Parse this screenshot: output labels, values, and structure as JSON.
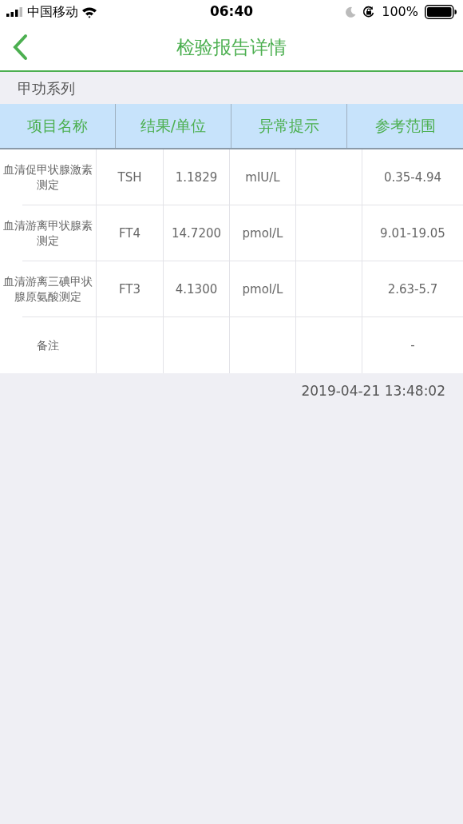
{
  "status_bar": {
    "carrier": "中国移动",
    "time": "06:40",
    "battery": "100%"
  },
  "nav": {
    "title": "检验报告详情"
  },
  "section": "甲功系列",
  "columns": [
    "项目名称",
    "结果/单位",
    "异常提示",
    "参考范围"
  ],
  "rows": [
    {
      "name": "血清促甲状腺激素测定",
      "code": "TSH",
      "value": "1.1829",
      "unit": "mIU/L",
      "range": "0.35-4.94"
    },
    {
      "name": "血清游离甲状腺素测定",
      "code": "FT4",
      "value": "14.7200",
      "unit": "pmol/L",
      "range": "9.01-19.05"
    },
    {
      "name": "血清游离三碘甲状腺原氨酸测定",
      "code": "FT3",
      "value": "4.1300",
      "unit": "pmol/L",
      "range": "2.63-5.7"
    }
  ],
  "remark": {
    "label": "备注",
    "value": "-"
  },
  "timestamp": "2019-04-21  13:48:02"
}
